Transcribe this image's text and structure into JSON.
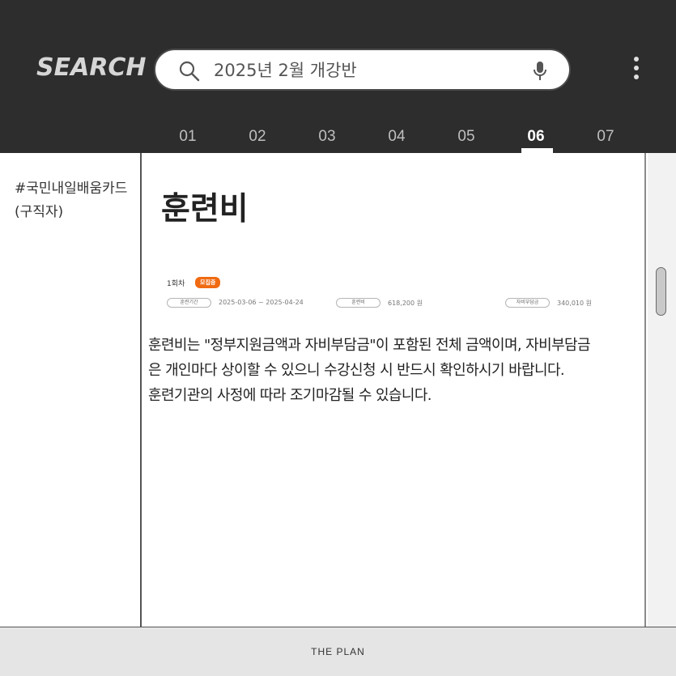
{
  "header": {
    "logo": "SEARCH",
    "search": {
      "value": "2025년 2월 개강반"
    },
    "icons": {
      "search": "search-icon",
      "mic": "microphone-icon",
      "more": "more-vertical-icon"
    }
  },
  "tabs": [
    "01",
    "02",
    "03",
    "04",
    "05",
    "06",
    "07"
  ],
  "active_tab": "06",
  "sidebar": {
    "tag_line1": "#국민내일배움카드",
    "tag_line2": "(구직자)"
  },
  "main": {
    "title": "훈련비",
    "fee": {
      "round": "1회차",
      "status": "모집중",
      "period_label": "훈련기간",
      "period_value": "2025-03-06 ~ 2025-04-24",
      "fee_label": "훈련비",
      "fee_value": "618,200 원",
      "self_label": "자비부담금",
      "self_value": "340,010 원"
    },
    "desc_line1": "훈련비는 \"정부지원금액과 자비부담금\"이 포함된 전체 금액이며, 자비부담금",
    "desc_line2": "은 개인마다 상이할 수 있으니 수강신청 시 반드시 확인하시기 바랍니다.",
    "desc_line3": "훈련기관의 사정에 따라 조기마감될 수 있습니다."
  },
  "footer": {
    "text": "THE PLAN"
  },
  "colors": {
    "header_bg": "#2d2d2d",
    "accent": "#f06a12",
    "footer_bg": "#e5e5e5"
  }
}
